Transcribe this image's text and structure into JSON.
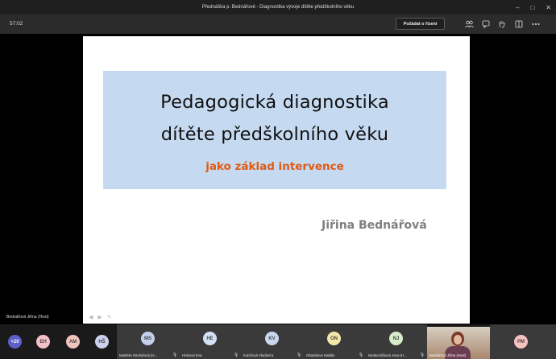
{
  "window": {
    "title": "Přednáška p. Bednářové - Diagnostika vývoje dítěte předškolního věku"
  },
  "toolbar": {
    "timer": "57:02",
    "raise_label": "Požádat o řízení",
    "icons": [
      "people-icon",
      "chat-icon",
      "raise-hand-icon",
      "rooms-icon",
      "more-icon"
    ]
  },
  "slide": {
    "title_lines": [
      "Pedagogická diagnostika",
      "dítěte předškolního věku"
    ],
    "subtitle": "jako základ intervence",
    "author": "Jiřina Bednářová",
    "colors": {
      "title_bg": "#c5d9f1",
      "subtitle": "#e05a14",
      "author": "#7f7f7f"
    }
  },
  "presenter_label": "Bednářová Jiřina (Host)",
  "participants": {
    "overflow": "+20",
    "small": [
      {
        "initials": "EH",
        "color": "#f4c1c8"
      },
      {
        "initials": "AM",
        "color": "#f1c3bd"
      },
      {
        "initials": "HŠ",
        "color": "#cdd0ec"
      }
    ],
    "tiles": [
      {
        "initials": "MS",
        "name": "Markéta Struhařová (H...",
        "color": "#c3d1ef"
      },
      {
        "initials": "HE",
        "name": "Hrsková Eva",
        "color": "#d3e2f4"
      },
      {
        "initials": "KV",
        "name": "Kubíčová Vladimíra",
        "color": "#cbd7ef"
      },
      {
        "initials": "ON",
        "name": "Obadalová Natálie",
        "color": "#f4e8a8"
      },
      {
        "initials": "NJ",
        "name": "Nedavoličková Jana (H...",
        "color": "#d7ecc9"
      }
    ],
    "video_name": "Bednářová Jiřina (Host)",
    "last": {
      "initials": "PM",
      "color": "#f5c2c0"
    }
  }
}
